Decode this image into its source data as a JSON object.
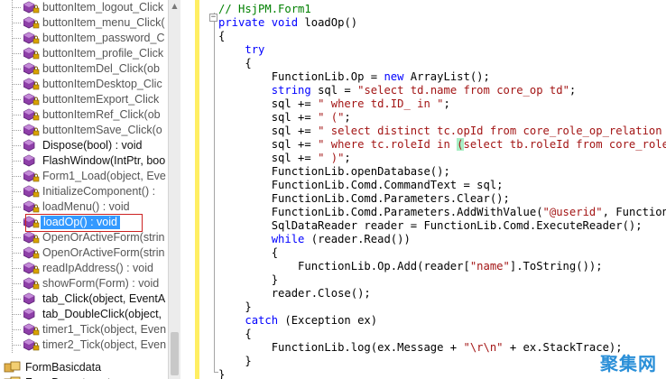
{
  "tree": {
    "items": [
      {
        "label": "buttonItem_logout_Click",
        "kind": "private"
      },
      {
        "label": "buttonItem_menu_Click(",
        "kind": "private"
      },
      {
        "label": "buttonItem_password_C",
        "kind": "private"
      },
      {
        "label": "buttonItem_profile_Click",
        "kind": "private"
      },
      {
        "label": "buttonItemDel_Click(ob",
        "kind": "private"
      },
      {
        "label": "buttonItemDesktop_Clic",
        "kind": "private"
      },
      {
        "label": "buttonItemExport_Click",
        "kind": "private"
      },
      {
        "label": "buttonItemRef_Click(ob",
        "kind": "private"
      },
      {
        "label": "buttonItemSave_Click(o",
        "kind": "private"
      },
      {
        "label": "Dispose(bool) : void",
        "kind": "public"
      },
      {
        "label": "FlashWindow(IntPtr, boo",
        "kind": "public"
      },
      {
        "label": "Form1_Load(object, Eve",
        "kind": "private"
      },
      {
        "label": "InitializeComponent() :",
        "kind": "private"
      },
      {
        "label": "loadMenu() : void",
        "kind": "private"
      },
      {
        "label": "loadOp() : void",
        "kind": "selected"
      },
      {
        "label": "OpenOrActiveForm(strin",
        "kind": "private"
      },
      {
        "label": "OpenOrActiveForm(strin",
        "kind": "private"
      },
      {
        "label": "readIpAddress() : void",
        "kind": "private"
      },
      {
        "label": "showForm(Form) : void",
        "kind": "private"
      },
      {
        "label": "tab_Click(object, EventA",
        "kind": "public"
      },
      {
        "label": "tab_DoubleClick(object,",
        "kind": "public"
      },
      {
        "label": "timer1_Tick(object, Even",
        "kind": "private"
      },
      {
        "label": "timer2_Tick(object, Even",
        "kind": "private"
      }
    ],
    "top_items": [
      {
        "label": "FormBasicdata"
      },
      {
        "label": "FormDepartment"
      }
    ]
  },
  "code": {
    "lines": [
      [
        {
          "t": "// HsjPM.Form1",
          "c": "cm"
        }
      ],
      [
        {
          "t": "private",
          "c": "kw"
        },
        {
          "t": " "
        },
        {
          "t": "void",
          "c": "kw"
        },
        {
          "t": " loadOp()"
        }
      ],
      [
        {
          "t": "{"
        }
      ],
      [
        {
          "t": "    "
        },
        {
          "t": "try",
          "c": "kw"
        }
      ],
      [
        {
          "t": "    {"
        }
      ],
      [
        {
          "t": "        FunctionLib.Op = "
        },
        {
          "t": "new",
          "c": "kw"
        },
        {
          "t": " ArrayList();"
        }
      ],
      [
        {
          "t": "        "
        },
        {
          "t": "string",
          "c": "kw"
        },
        {
          "t": " sql = "
        },
        {
          "t": "\"select td.name from core_op td\"",
          "c": "st"
        },
        {
          "t": ";"
        }
      ],
      [
        {
          "t": "        sql += "
        },
        {
          "t": "\" where td.ID_ in \"",
          "c": "st"
        },
        {
          "t": ";"
        }
      ],
      [
        {
          "t": "        sql += "
        },
        {
          "t": "\" (\"",
          "c": "st"
        },
        {
          "t": ";"
        }
      ],
      [
        {
          "t": "        sql += "
        },
        {
          "t": "\" select distinct tc.opId from core_role_op_relation tc",
          "c": "st"
        }
      ],
      [
        {
          "t": "        sql += "
        },
        {
          "t": "\" where tc.roleId in ",
          "c": "st"
        },
        {
          "t": "(",
          "c": "st hl"
        },
        {
          "t": "select tb.roleId from core_role_us",
          "c": "st"
        }
      ],
      [
        {
          "t": "        sql += "
        },
        {
          "t": "\" )\"",
          "c": "st"
        },
        {
          "t": ";"
        }
      ],
      [
        {
          "t": "        FunctionLib.openDatabase();"
        }
      ],
      [
        {
          "t": "        FunctionLib.Comd.CommandText = sql;"
        }
      ],
      [
        {
          "t": "        FunctionLib.Comd.Parameters.Clear();"
        }
      ],
      [
        {
          "t": "        FunctionLib.Comd.Parameters.AddWithValue("
        },
        {
          "t": "\"@userid\"",
          "c": "st"
        },
        {
          "t": ", FunctionLib"
        }
      ],
      [
        {
          "t": "        SqlDataReader reader = FunctionLib.Comd.ExecuteReader();"
        }
      ],
      [
        {
          "t": "        "
        },
        {
          "t": "while",
          "c": "kw"
        },
        {
          "t": " (reader.Read())"
        }
      ],
      [
        {
          "t": "        {"
        }
      ],
      [
        {
          "t": "            FunctionLib.Op.Add(reader["
        },
        {
          "t": "\"name\"",
          "c": "st"
        },
        {
          "t": "].ToString());"
        }
      ],
      [
        {
          "t": "        }"
        }
      ],
      [
        {
          "t": "        reader.Close();"
        }
      ],
      [
        {
          "t": "    }"
        }
      ],
      [
        {
          "t": "    "
        },
        {
          "t": "catch",
          "c": "kw"
        },
        {
          "t": " (Exception ex)"
        }
      ],
      [
        {
          "t": "    {"
        }
      ],
      [
        {
          "t": "        FunctionLib.log(ex.Message + "
        },
        {
          "t": "\"\\r\\n\"",
          "c": "st"
        },
        {
          "t": " + ex.StackTrace);"
        }
      ],
      [
        {
          "t": "    }"
        }
      ],
      [
        {
          "t": "}"
        }
      ]
    ]
  },
  "watermark": "聚集网",
  "colors": {
    "keyword": "#0000ff",
    "string": "#a31515",
    "comment": "#008000",
    "selection": "#3399ff",
    "selection_frame": "#cc2222",
    "method_icon_public": "#8e3fa8",
    "method_icon_private": "#8e3fa8"
  },
  "icons": {
    "method": "method-icon",
    "private_method": "private-method-icon",
    "class": "class-icon"
  }
}
